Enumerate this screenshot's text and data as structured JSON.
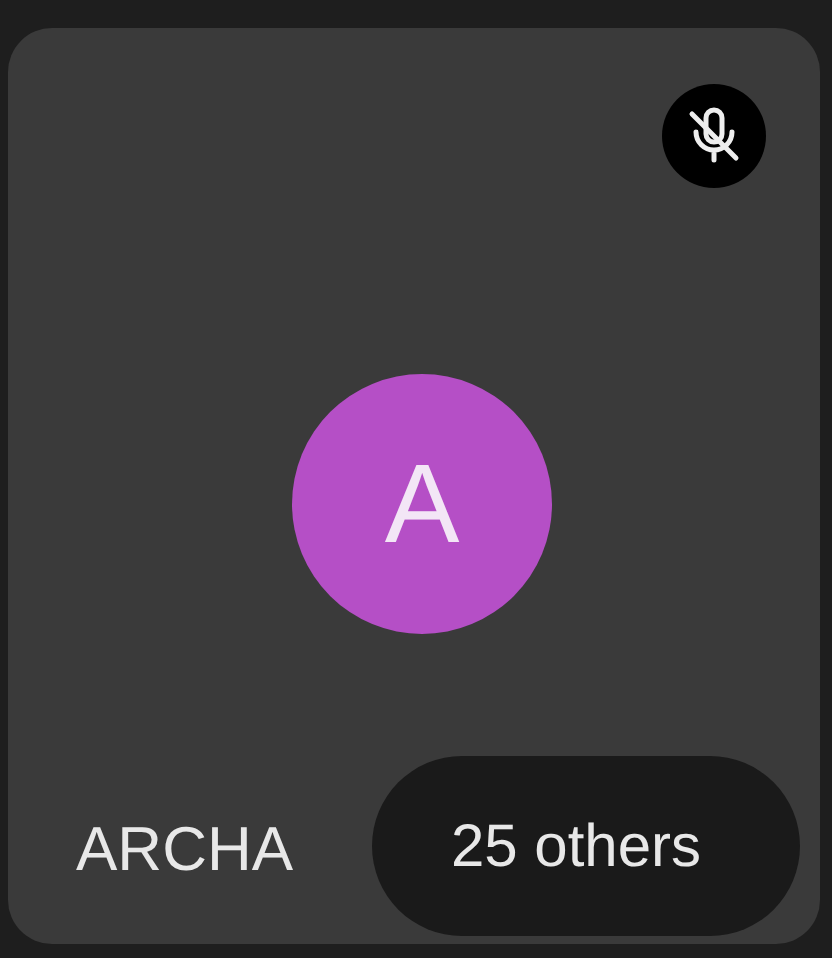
{
  "participant": {
    "initial": "A",
    "name": "ARCHA",
    "muted": true
  },
  "others_chip": {
    "label": "25 others"
  }
}
